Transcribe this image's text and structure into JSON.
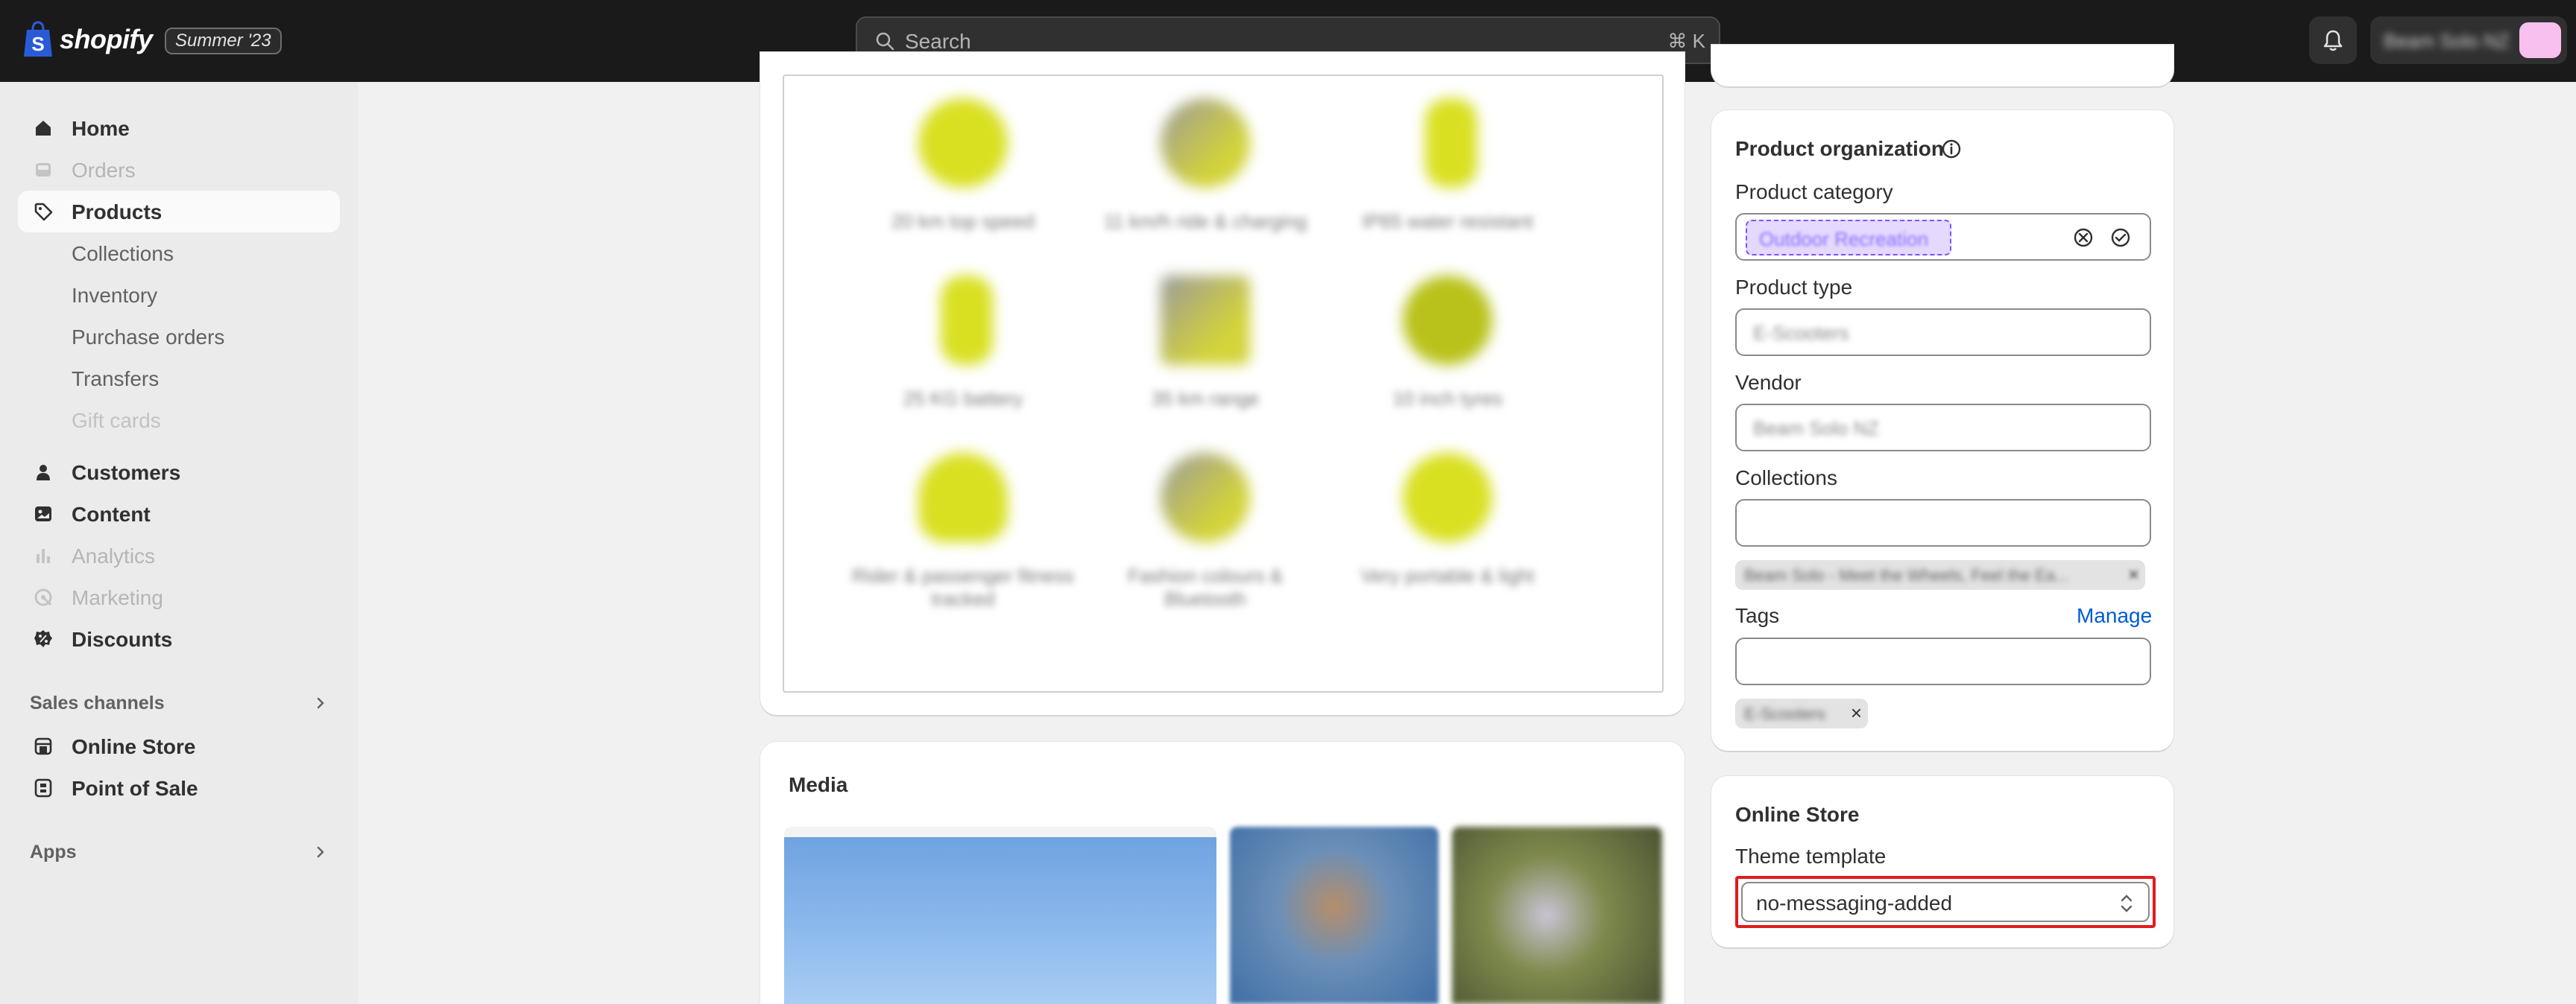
{
  "topbar": {
    "logo_text": "shopify",
    "edition_badge": "Summer '23",
    "search_placeholder": "Search",
    "search_shortcut": "⌘ K",
    "store_name": "Beam Solo NZ"
  },
  "sidebar": {
    "items": [
      {
        "label": "Home",
        "icon": "home-icon"
      },
      {
        "label": "Orders",
        "icon": "inbox-icon"
      },
      {
        "label": "Products",
        "icon": "tag-icon"
      },
      {
        "label": "Customers",
        "icon": "person-icon"
      },
      {
        "label": "Content",
        "icon": "image-icon"
      },
      {
        "label": "Analytics",
        "icon": "bar-chart-icon"
      },
      {
        "label": "Marketing",
        "icon": "target-icon"
      },
      {
        "label": "Discounts",
        "icon": "discount-icon"
      }
    ],
    "product_subitems": [
      "Collections",
      "Inventory",
      "Purchase orders",
      "Transfers",
      "Gift cards"
    ],
    "sales_channels_label": "Sales channels",
    "channels": [
      {
        "label": "Online Store",
        "icon": "store-icon"
      },
      {
        "label": "Point of Sale",
        "icon": "pos-icon"
      }
    ],
    "apps_label": "Apps"
  },
  "icon_grid": {
    "captions": [
      "20 km top speed",
      "11 km/h ride & charging",
      "IP65 water resistant",
      "25 KG battery",
      "35 km range",
      "10 inch tyres",
      "Rider & passenger fitness tracked",
      "Fashion colours & Bluetooth",
      "Very portable & light"
    ]
  },
  "media": {
    "title": "Media"
  },
  "product_organization": {
    "title": "Product organization",
    "category_label": "Product category",
    "category_value": "Outdoor Recreation",
    "type_label": "Product type",
    "type_value": "E-Scooters",
    "vendor_label": "Vendor",
    "vendor_value": "Beam Solo NZ",
    "collections_label": "Collections",
    "collection_chip": "Beam Solo - Meet the Wheels, Feel the Ea...",
    "tags_label": "Tags",
    "manage_link": "Manage",
    "tag_chip": "E-Scooters"
  },
  "online_store": {
    "title": "Online Store",
    "template_label": "Theme template",
    "template_value": "no-messaging-added"
  }
}
